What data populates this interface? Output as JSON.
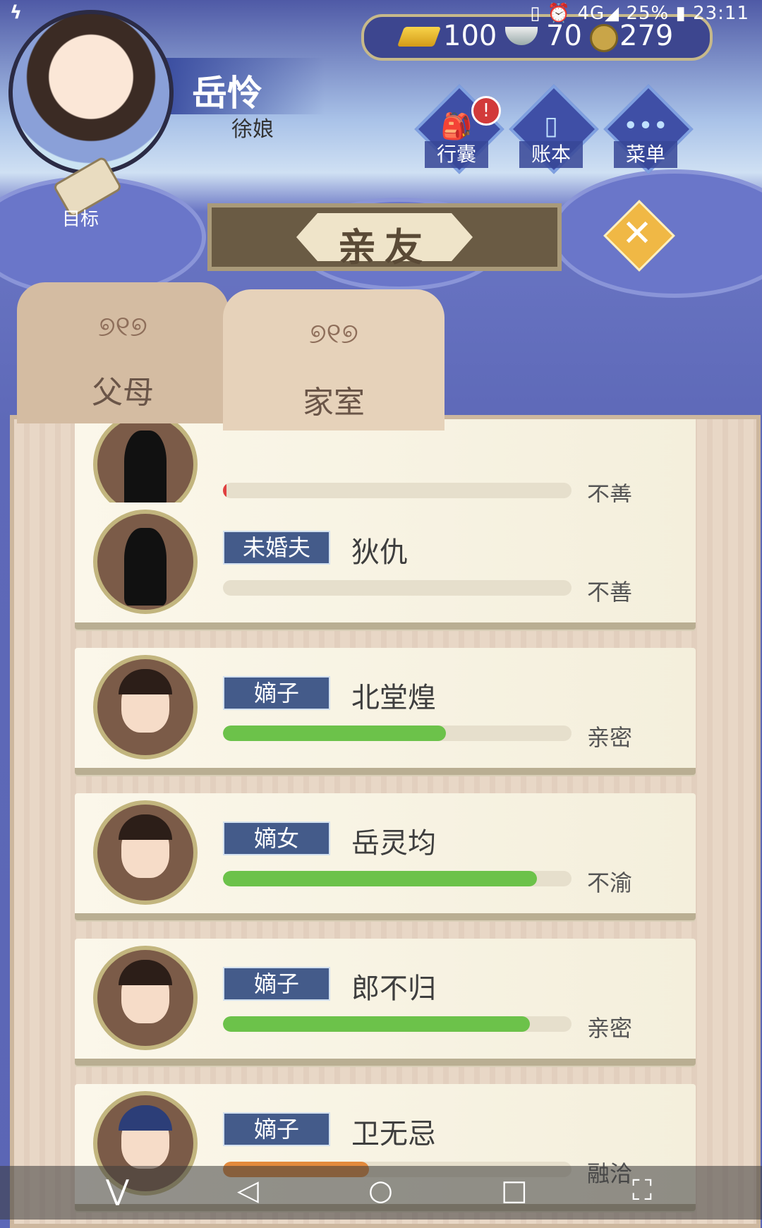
{
  "status_bar": {
    "left": "ϟ",
    "right": "▯ ⏰ 4G◢  25% ▮ 23:11"
  },
  "currency": {
    "gold": "100",
    "silver": "70",
    "coins": "279"
  },
  "player": {
    "name": "岳怜",
    "title": "徐娘"
  },
  "goal_label": "目标",
  "top_buttons": [
    {
      "label": "行囊",
      "glyph": "🎒",
      "alert": "!"
    },
    {
      "label": "账本",
      "glyph": "▯"
    },
    {
      "label": "菜单",
      "glyph": "•••"
    }
  ],
  "title": "亲友",
  "close": "✕",
  "tabs": [
    {
      "label": "父母",
      "deco": "୭୧୭"
    },
    {
      "label": "家室",
      "deco": "୭୧୭"
    }
  ],
  "relatives": [
    {
      "relation": "",
      "name": "",
      "status": "不善",
      "affinity": 0.01,
      "bar_color": "#e04040"
    },
    {
      "relation": "未婚夫",
      "name": "狄仇",
      "status": "不善",
      "affinity": 0.0,
      "bar_color": "#6cc24a"
    },
    {
      "relation": "嫡子",
      "name": "北堂煌",
      "status": "亲密",
      "affinity": 0.64,
      "bar_color": "#6cc24a"
    },
    {
      "relation": "嫡女",
      "name": "岳灵均",
      "status": "不渝",
      "affinity": 0.9,
      "bar_color": "#6cc24a"
    },
    {
      "relation": "嫡子",
      "name": "郎不归",
      "status": "亲密",
      "affinity": 0.88,
      "bar_color": "#6cc24a"
    },
    {
      "relation": "嫡子",
      "name": "卫无忌",
      "status": "融洽",
      "affinity": 0.42,
      "bar_color": "#e38a3c"
    }
  ],
  "nav_bar": {
    "down": "⋁",
    "back": "◁",
    "home": "○",
    "recents": "□",
    "capture": "⛶"
  }
}
